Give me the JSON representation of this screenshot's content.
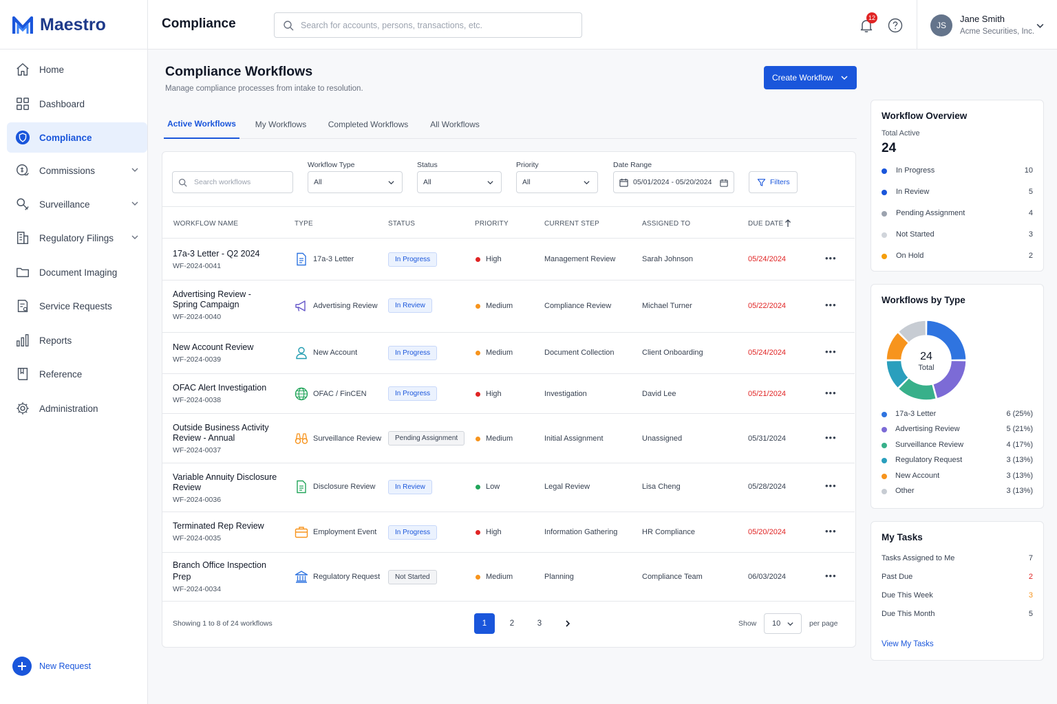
{
  "app": {
    "name": "Maestro"
  },
  "sidebar": {
    "items": [
      {
        "label": "Home",
        "icon": "home-icon"
      },
      {
        "label": "Dashboard",
        "icon": "grid-icon"
      },
      {
        "label": "Compliance",
        "icon": "shield-icon",
        "active": true
      },
      {
        "label": "Commissions",
        "icon": "coins-icon",
        "expandable": true
      },
      {
        "label": "Surveillance",
        "icon": "magnifier-icon",
        "expandable": true
      },
      {
        "label": "Regulatory Filings",
        "icon": "building-icon",
        "expandable": true
      },
      {
        "label": "Document Imaging",
        "icon": "folder-icon"
      },
      {
        "label": "Service Requests",
        "icon": "request-icon"
      },
      {
        "label": "Reports",
        "icon": "bar-chart-icon"
      },
      {
        "label": "Reference",
        "icon": "book-icon"
      },
      {
        "label": "Administration",
        "icon": "gear-icon"
      }
    ],
    "new_request_label": "New Request"
  },
  "header": {
    "title": "Compliance",
    "search_placeholder": "Search for accounts, persons, transactions, etc.",
    "notification_count": "12",
    "user": {
      "initials": "JS",
      "name": "Jane Smith",
      "company": "Acme Securities, Inc."
    }
  },
  "main": {
    "title": "Compliance Workflows",
    "subtitle": "Manage compliance processes from intake to resolution.",
    "create_label": "Create Workflow",
    "tabs": [
      "Active Workflows",
      "My Workflows",
      "Completed Workflows",
      "All Workflows"
    ],
    "filters": {
      "search_placeholder": "Search workflows",
      "type_label": "Workflow Type",
      "type_value": "All",
      "status_label": "Status",
      "status_value": "All",
      "priority_label": "Priority",
      "priority_value": "All",
      "date_label": "Date Range",
      "date_value": "05/01/2024 - 05/20/2024",
      "filters_button": "Filters"
    },
    "columns": [
      "WORKFLOW NAME",
      "TYPE",
      "STATUS",
      "PRIORITY",
      "CURRENT STEP",
      "ASSIGNED TO",
      "DUE DATE"
    ],
    "rows": [
      {
        "name": "17a-3 Letter - Q2 2024",
        "id": "WF-2024-0041",
        "type": "17a-3 Letter",
        "status": "In Progress",
        "priority": "High",
        "step": "Management Review",
        "assigned": "Sarah Johnson",
        "due": "05/24/2024"
      },
      {
        "name": "Advertising Review -",
        "name2": "Spring Campaign",
        "id": "WF-2024-0040",
        "type": "Advertising Review",
        "status": "In Review",
        "priority": "Medium",
        "step": "Compliance Review",
        "assigned": "Michael Turner",
        "due": "05/22/2024"
      },
      {
        "name": "New Account Review",
        "id": "WF-2024-0039",
        "type": "New Account",
        "status": "In Progress",
        "priority": "Medium",
        "step": "Document Collection",
        "assigned": "Client Onboarding",
        "due": "05/24/2024"
      },
      {
        "name": "OFAC Alert Investigation",
        "id": "WF-2024-0038",
        "type": "OFAC / FinCEN",
        "status": "In Progress",
        "priority": "High",
        "step": "Investigation",
        "assigned": "David Lee",
        "due": "05/21/2024"
      },
      {
        "name": "Outside Business Activity",
        "name2": "Review - Annual",
        "id": "WF-2024-0037",
        "type": "Surveillance Review",
        "status": "Pending Assignment",
        "priority": "Medium",
        "step": "Initial Assignment",
        "assigned": "Unassigned",
        "due": "05/31/2024"
      },
      {
        "name": "Variable Annuity Disclosure",
        "name2": "Review",
        "id": "WF-2024-0036",
        "type": "Disclosure Review",
        "status": "In Review",
        "priority": "Low",
        "step": "Legal Review",
        "assigned": "Lisa Cheng",
        "due": "05/28/2024"
      },
      {
        "name": "Terminated Rep Review",
        "id": "WF-2024-0035",
        "type": "Employment Event",
        "status": "In Progress",
        "priority": "High",
        "step": "Information Gathering",
        "assigned": "HR Compliance",
        "due": "05/20/2024"
      },
      {
        "name": "Branch Office Inspection",
        "name2": "Prep",
        "id": "WF-2024-0034",
        "type": "Regulatory Request",
        "status": "Not Started",
        "priority": "Medium",
        "step": "Planning",
        "assigned": "Compliance Team",
        "due": "06/03/2024"
      }
    ],
    "footer": {
      "showing": "Showing 1 to 8 of 24 workflows",
      "pages": [
        "1",
        "2",
        "3"
      ],
      "show_label": "Show",
      "per_page_value": "10",
      "per_page_label": "per page"
    }
  },
  "overview": {
    "title": "Workflow Overview",
    "total_label": "Total Active",
    "total": "24",
    "stats": [
      {
        "label": "In Progress",
        "value": "10",
        "color": "#1a56db"
      },
      {
        "label": "In Review",
        "value": "5",
        "color": "#1a56db"
      },
      {
        "label": "Pending Assignment",
        "value": "4",
        "color": "#9ca3af"
      },
      {
        "label": "Not Started",
        "value": "3",
        "color": "#d1d5db"
      },
      {
        "label": "On Hold",
        "value": "2",
        "color": "#f59e0b"
      }
    ]
  },
  "by_type": {
    "title": "Workflows by Type",
    "center_value": "24",
    "center_label": "Total",
    "items": [
      {
        "label": "17a-3 Letter",
        "value": "6 (25%)",
        "count": 6,
        "color": "#2f74e0"
      },
      {
        "label": "Advertising Review",
        "value": "5 (21%)",
        "count": 5,
        "color": "#7c6bd6"
      },
      {
        "label": "Surveillance Review",
        "value": "4 (17%)",
        "count": 4,
        "color": "#38b08a"
      },
      {
        "label": "Regulatory Request",
        "value": "3 (13%)",
        "count": 3,
        "color": "#2a9fbd"
      },
      {
        "label": "New Account",
        "value": "3 (13%)",
        "count": 3,
        "color": "#f7941d"
      },
      {
        "label": "Other",
        "value": "3 (13%)",
        "count": 3,
        "color": "#c7ccd3"
      }
    ]
  },
  "tasks": {
    "title": "My Tasks",
    "items": [
      {
        "label": "Tasks Assigned to Me",
        "value": "7",
        "color": "#374151"
      },
      {
        "label": "Past Due",
        "value": "2",
        "color": "#e02424"
      },
      {
        "label": "Due This Week",
        "value": "3",
        "color": "#f7941d"
      },
      {
        "label": "Due This Month",
        "value": "5",
        "color": "#374151"
      }
    ],
    "link": "View My Tasks"
  },
  "colors": {
    "accent": "#1a56db",
    "high": "#e02424",
    "medium": "#f7941d",
    "low": "#22a55a",
    "overdue": "#e02424"
  }
}
